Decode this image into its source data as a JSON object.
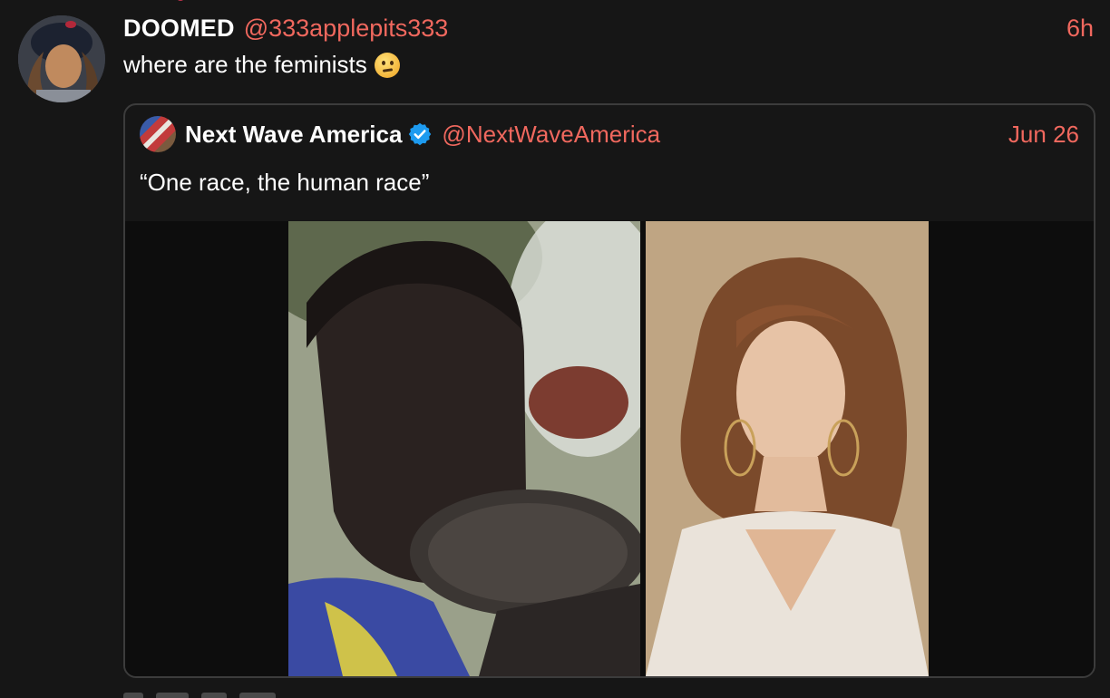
{
  "tweet": {
    "author_name": "DOOMED",
    "author_handle": "@333applepits333",
    "timestamp": "6h",
    "text": "where are the feminists",
    "emoji": "thinking-face"
  },
  "quoted_tweet": {
    "author_name": "Next Wave America",
    "verified": true,
    "author_handle": "@NextWaveAmerica",
    "date": "Jun 26",
    "text": "“One race, the human race”",
    "media": [
      {
        "description_icon": "photo-woman-with-lip-plate"
      },
      {
        "description_icon": "photo-woman-portrait"
      }
    ]
  },
  "colors": {
    "background": "#161616",
    "accent_link": "#f0685e",
    "card_border": "#3c3c3c",
    "verified_badge": "#1d9bf0"
  }
}
